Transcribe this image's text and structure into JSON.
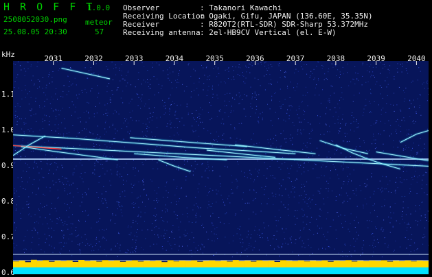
{
  "header": {
    "app_name": "H R O F F T",
    "version": "1.0.0",
    "filename": "2508052030.png",
    "datetime": "25.08.05 20:30",
    "meteor_label": "meteor",
    "meteor_count": "57",
    "fields": [
      {
        "label": "Observer",
        "value": ": Takanori Kawachi"
      },
      {
        "label": "Receiving Location",
        "value": ": Ogaki, Gifu, JAPAN (136.60E, 35.35N)"
      },
      {
        "label": "Receiver",
        "value": ": R820T2(RTL-SDR) SDR-Sharp 53.372MHz"
      },
      {
        "label": "Receiving antenna",
        "value": ": 2el-HB9CV Vertical (el. E-W)"
      }
    ]
  },
  "colors": {
    "background": "#07155a",
    "text_green": "#00d000",
    "text_white": "#f0f0f0",
    "power_bar": "#ffd700",
    "baseline": "#00e0ff",
    "trace_cyan": "#40e8ff",
    "trace_hot": "#ff4040"
  },
  "chart_data": {
    "type": "heatmap",
    "title": "",
    "ylabel": "kHz",
    "xlabel": "",
    "x_ticks": [
      "2031",
      "2032",
      "2033",
      "2034",
      "2035",
      "2036",
      "2037",
      "2038",
      "2039",
      "2040"
    ],
    "y_ticks": [
      "1.1",
      "1.0",
      "0.9",
      "0.8",
      "0.7",
      "0.6"
    ],
    "y_tick_values": [
      1.1,
      1.0,
      0.9,
      0.8,
      0.7,
      0.6
    ],
    "xlim": [
      2030.0,
      2040.3
    ],
    "ylim": [
      0.597,
      1.195
    ],
    "reference_line_khz": 0.92,
    "series": [
      {
        "values": [
          [
            2030.0,
            0.958
          ],
          [
            2040.3,
            0.9
          ]
        ]
      },
      {
        "values": [
          [
            2030.0,
            0.988
          ],
          [
            2031.5,
            0.978
          ],
          [
            2033.0,
            0.965
          ],
          [
            2034.5,
            0.952
          ],
          [
            2036.0,
            0.942
          ],
          [
            2037.0,
            0.935
          ]
        ]
      },
      {
        "values": [
          [
            2030.2,
            0.955
          ],
          [
            2031.0,
            0.942
          ],
          [
            2031.8,
            0.93
          ],
          [
            2032.6,
            0.918
          ]
        ]
      },
      {
        "values": [
          [
            2032.9,
            0.98
          ],
          [
            2034.5,
            0.966
          ],
          [
            2035.8,
            0.955
          ]
        ]
      },
      {
        "values": [
          [
            2033.0,
            0.935
          ],
          [
            2034.2,
            0.925
          ],
          [
            2035.3,
            0.918
          ]
        ]
      },
      {
        "values": [
          [
            2033.6,
            0.918
          ],
          [
            2034.0,
            0.9
          ],
          [
            2034.4,
            0.885
          ]
        ]
      },
      {
        "values": [
          [
            2034.8,
            0.945
          ],
          [
            2035.8,
            0.933
          ],
          [
            2036.5,
            0.925
          ]
        ]
      },
      {
        "values": [
          [
            2035.5,
            0.96
          ],
          [
            2036.6,
            0.946
          ],
          [
            2037.5,
            0.935
          ]
        ]
      },
      {
        "values": [
          [
            2037.6,
            0.972
          ],
          [
            2038.2,
            0.95
          ],
          [
            2038.8,
            0.935
          ]
        ]
      },
      {
        "values": [
          [
            2038.0,
            0.96
          ],
          [
            2038.4,
            0.938
          ],
          [
            2038.8,
            0.92
          ],
          [
            2039.2,
            0.905
          ],
          [
            2039.6,
            0.892
          ]
        ]
      },
      {
        "values": [
          [
            2039.0,
            0.94
          ],
          [
            2039.8,
            0.925
          ],
          [
            2040.3,
            0.915
          ]
        ]
      },
      {
        "values": [
          [
            2039.6,
            0.967
          ],
          [
            2040.0,
            0.99
          ],
          [
            2040.3,
            1.0
          ]
        ]
      },
      {
        "values": [
          [
            2030.0,
            0.93
          ],
          [
            2030.4,
            0.96
          ],
          [
            2030.8,
            0.985
          ]
        ]
      },
      {
        "values": [
          [
            2031.2,
            1.175
          ],
          [
            2031.8,
            1.16
          ],
          [
            2032.4,
            1.145
          ]
        ]
      }
    ],
    "power_bars": [
      0.55,
      0.62,
      0.48,
      0.7,
      0.58,
      0.66,
      0.52,
      0.61,
      0.57,
      0.64,
      0.5,
      0.69,
      0.56,
      0.6,
      0.53,
      0.67,
      0.59,
      0.63,
      0.51,
      0.58,
      0.65,
      0.54,
      0.6,
      0.57,
      0.62,
      0.49,
      0.66,
      0.55,
      0.61,
      0.58,
      0.64,
      0.52,
      0.59,
      0.63,
      0.56,
      0.6,
      0.54,
      0.68,
      0.57,
      0.61,
      0.53,
      0.65,
      0.58,
      0.62,
      0.5,
      0.66,
      0.59,
      0.56,
      0.63,
      0.55,
      0.6,
      0.57,
      0.64,
      0.52,
      0.61,
      0.58,
      0.67,
      0.54,
      0.6,
      0.56,
      0.62,
      0.59,
      0.65,
      0.53,
      0.6,
      0.57,
      0.63,
      0.55,
      0.61,
      0.58
    ],
    "grid": false
  }
}
